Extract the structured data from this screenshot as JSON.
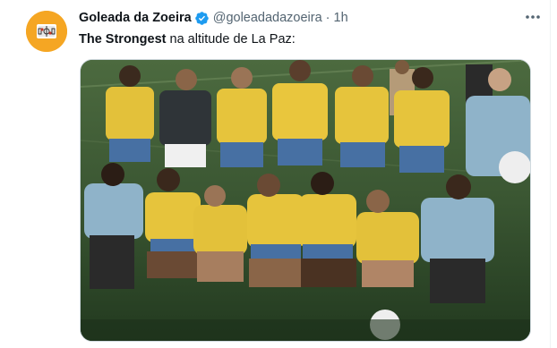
{
  "tweet": {
    "display_name": "Goleada da Zoeira",
    "handle": "@goleadadazoeira",
    "separator": "·",
    "time": "1h",
    "text_bold": "The Strongest",
    "text_rest": " na altitude de La Paz:",
    "verified_icon": "verified-badge-icon",
    "more_icon": "more-horizontal-icon",
    "media_alt": "Brazil 1970 team photo"
  },
  "colors": {
    "avatar_bg": "#f5a623",
    "verified_blue": "#1d9bf0",
    "jersey_yellow": "#e9c63a",
    "shorts_blue": "#3f6fa8",
    "pitch_green": "#355230"
  }
}
